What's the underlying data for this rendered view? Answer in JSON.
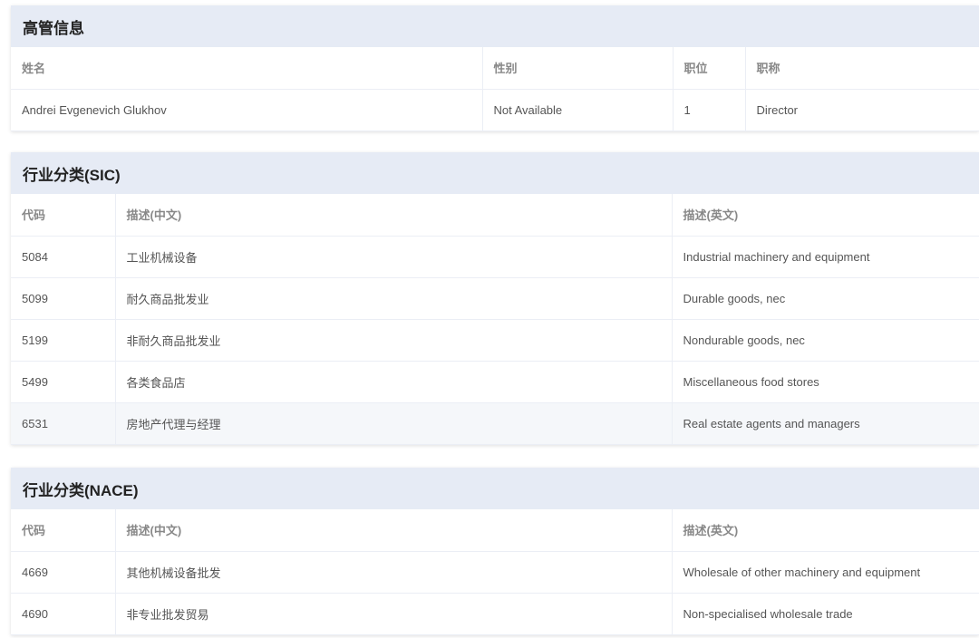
{
  "executives": {
    "title": "高管信息",
    "headers": [
      "姓名",
      "性别",
      "职位",
      "职称"
    ],
    "rows": [
      [
        "Andrei Evgenevich Glukhov",
        "Not Available",
        "1",
        "Director"
      ]
    ]
  },
  "sic": {
    "title": "行业分类(SIC)",
    "headers": [
      "代码",
      "描述(中文)",
      "描述(英文)"
    ],
    "rows": [
      [
        "5084",
        "工业机械设备",
        "Industrial machinery and equipment"
      ],
      [
        "5099",
        "耐久商品批发业",
        "Durable goods, nec"
      ],
      [
        "5199",
        "非耐久商品批发业",
        "Nondurable goods, nec"
      ],
      [
        "5499",
        "各类食品店",
        "Miscellaneous food stores"
      ],
      [
        "6531",
        "房地产代理与经理",
        "Real estate agents and managers"
      ]
    ]
  },
  "nace": {
    "title": "行业分类(NACE)",
    "headers": [
      "代码",
      "描述(中文)",
      "描述(英文)"
    ],
    "rows": [
      [
        "4669",
        "其他机械设备批发",
        "Wholesale of other machinery and equipment"
      ],
      [
        "4690",
        "非专业批发贸易",
        "Non-specialised wholesale trade"
      ]
    ]
  }
}
